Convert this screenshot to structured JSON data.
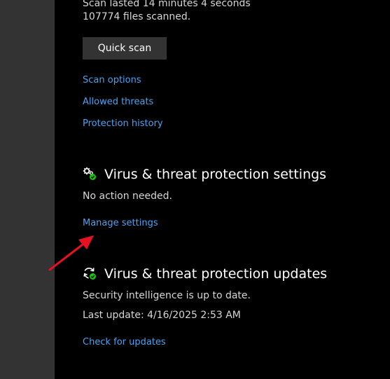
{
  "scan": {
    "duration_line": "Scan lasted 14 minutes 4 seconds",
    "files_line": "107774 files scanned.",
    "quick_scan_label": "Quick scan"
  },
  "links": {
    "scan_options": "Scan options",
    "allowed_threats": "Allowed threats",
    "protection_history": "Protection history"
  },
  "settings_section": {
    "title": "Virus & threat protection settings",
    "status": "No action needed.",
    "manage_link": "Manage settings"
  },
  "updates_section": {
    "title": "Virus & threat protection updates",
    "status": "Security intelligence is up to date.",
    "last_update": "Last update: 4/16/2025 2:53 AM",
    "check_link": "Check for updates"
  },
  "colors": {
    "link": "#4aa3f0",
    "ok_badge": "#16c60c",
    "annotation_arrow": "#e81123"
  },
  "icons": {
    "settings": "gears-check-icon",
    "updates": "refresh-check-icon",
    "annotation": "red-arrow-icon"
  }
}
